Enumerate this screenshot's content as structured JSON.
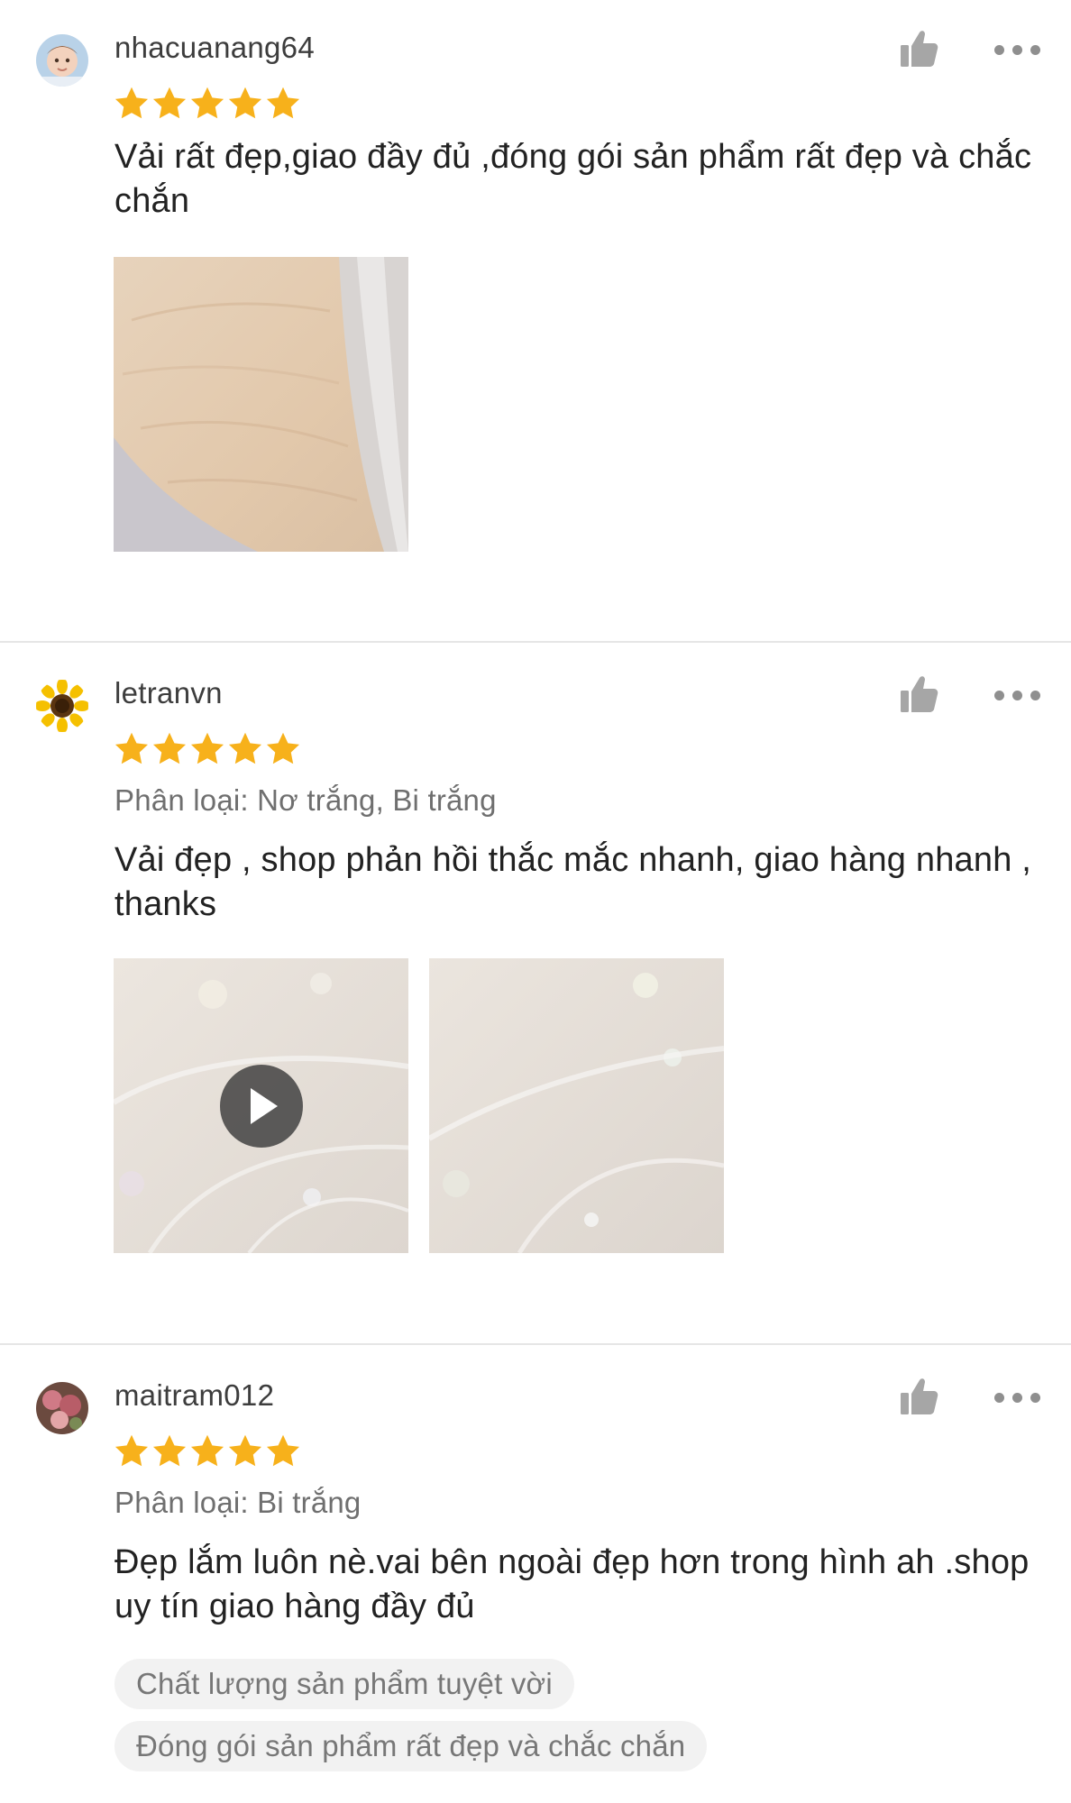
{
  "accent_color": "#f7b11b",
  "reviews": [
    {
      "username": "nhacuanang64",
      "rating": 5,
      "comment": "Vải rất đẹp,giao đầy đủ ,đóng gói sản phẩm rất đẹp và chắc chắn",
      "avatar_icon": "baby-photo-avatar",
      "like_icon": "thumbs-up-icon",
      "more_icon": "more-options-icon"
    },
    {
      "username": "letranvn",
      "rating": 5,
      "variation": "Phân loại: Nơ trắng, Bi trắng",
      "comment": "Vải đẹp , shop phản hồi thắc mắc nhanh, giao hàng nhanh , thanks",
      "avatar_icon": "sunflower-avatar",
      "like_icon": "thumbs-up-icon",
      "more_icon": "more-options-icon"
    },
    {
      "username": "maitram012",
      "rating": 5,
      "variation": "Phân loại: Bi trắng",
      "comment": "Đẹp lắm luôn nè.vai bên ngoài đẹp hơn trong hình ah .shop uy tín giao hàng đầy đủ",
      "tags": [
        "Chất lượng sản phẩm tuyệt vời",
        "Đóng gói sản phẩm rất đẹp và chắc chắn"
      ],
      "avatar_icon": "flowers-photo-avatar",
      "like_icon": "thumbs-up-icon",
      "more_icon": "more-options-icon"
    }
  ]
}
